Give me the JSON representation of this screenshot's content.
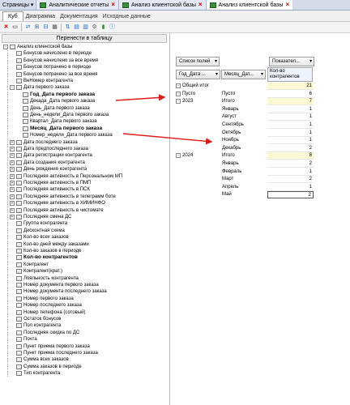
{
  "tabs": {
    "pages": "Страницы",
    "items": [
      {
        "label": "Аналитические отчеты"
      },
      {
        "label": "Анализ клиентской базы"
      },
      {
        "label": "Анализ клиентской базы"
      }
    ]
  },
  "subtabs": {
    "cube": "Куб",
    "diagram": "Диаграмма",
    "docs": "Документация",
    "source": "Исходные данные"
  },
  "left": {
    "move_button": "Перенести в таблицу",
    "tree": [
      {
        "label": "Анализ клиентской базы",
        "lvl": 0,
        "exp": "-",
        "bold": false
      },
      {
        "label": "Бонусов начислено в периоде",
        "lvl": 1,
        "exp": "",
        "bold": false
      },
      {
        "label": "Бонусов начислено за все время",
        "lvl": 1,
        "exp": "",
        "bold": false
      },
      {
        "label": "Бонусов потрачено в периоде",
        "lvl": 1,
        "exp": "",
        "bold": false
      },
      {
        "label": "Бонусов потрачено за все время",
        "lvl": 1,
        "exp": "",
        "bold": false
      },
      {
        "label": "ВнНомер контрагента",
        "lvl": 1,
        "exp": "",
        "bold": false
      },
      {
        "label": "Дата первого заказа",
        "lvl": 1,
        "exp": "-",
        "bold": false
      },
      {
        "label": "Год_Дата первого заказа",
        "lvl": 2,
        "exp": "",
        "bold": true
      },
      {
        "label": "Декада_Дата первого заказа",
        "lvl": 2,
        "exp": "",
        "bold": false
      },
      {
        "label": "День_Дата первого заказа",
        "lvl": 2,
        "exp": "",
        "bold": false
      },
      {
        "label": "День_недели_Дата первого заказа",
        "lvl": 2,
        "exp": "",
        "bold": false
      },
      {
        "label": "Квартал_Дата первого заказа",
        "lvl": 2,
        "exp": "",
        "bold": false
      },
      {
        "label": "Месяц_Дата первого заказа",
        "lvl": 2,
        "exp": "",
        "bold": true
      },
      {
        "label": "Номер_недели_Дата первого заказа",
        "lvl": 2,
        "exp": "",
        "bold": false
      },
      {
        "label": "Дата последнего заказа",
        "lvl": 1,
        "exp": "+",
        "bold": false
      },
      {
        "label": "Дата предпоследнего заказа",
        "lvl": 1,
        "exp": "+",
        "bold": false
      },
      {
        "label": "Дата регистрации контрагента",
        "lvl": 1,
        "exp": "+",
        "bold": false
      },
      {
        "label": "Дата создания контрагента",
        "lvl": 1,
        "exp": "+",
        "bold": false
      },
      {
        "label": "День рождения контрагента",
        "lvl": 1,
        "exp": "+",
        "bold": false
      },
      {
        "label": "Последняя активность в Персональном МП",
        "lvl": 1,
        "exp": "+",
        "bold": false
      },
      {
        "label": "Последняя активность в ПМП",
        "lvl": 1,
        "exp": "+",
        "bold": false
      },
      {
        "label": "Последняя активность в ПСК",
        "lvl": 1,
        "exp": "+",
        "bold": false
      },
      {
        "label": "Последняя активность в телеграмм боте",
        "lvl": 1,
        "exp": "+",
        "bold": false
      },
      {
        "label": "Последняя активность в ХИМИНФО",
        "lvl": 1,
        "exp": "+",
        "bold": false
      },
      {
        "label": "Последняя активность в чистомате",
        "lvl": 1,
        "exp": "+",
        "bold": false
      },
      {
        "label": "Последняя смена ДС",
        "lvl": 1,
        "exp": "+",
        "bold": false
      },
      {
        "label": "Группа контрагента",
        "lvl": 1,
        "exp": "",
        "bold": false
      },
      {
        "label": "Дисконтная схема",
        "lvl": 1,
        "exp": "",
        "bold": false
      },
      {
        "label": "Кол-во всех заказов",
        "lvl": 1,
        "exp": "",
        "bold": false
      },
      {
        "label": "Кол-во дней между заказами",
        "lvl": 1,
        "exp": "",
        "bold": false
      },
      {
        "label": "Кол-во заказов в периоде",
        "lvl": 1,
        "exp": "",
        "bold": false
      },
      {
        "label": "Кол-во контрагентов",
        "lvl": 1,
        "exp": "",
        "bold": true
      },
      {
        "label": "Контрагент",
        "lvl": 1,
        "exp": "",
        "bold": false
      },
      {
        "label": "Контрагент(крат.)",
        "lvl": 1,
        "exp": "",
        "bold": false
      },
      {
        "label": "Лояльность контрагента",
        "lvl": 1,
        "exp": "",
        "bold": false
      },
      {
        "label": "Номер документа первого заказа",
        "lvl": 1,
        "exp": "",
        "bold": false
      },
      {
        "label": "Номер документа последнего заказа",
        "lvl": 1,
        "exp": "",
        "bold": false
      },
      {
        "label": "Номер первого заказа",
        "lvl": 1,
        "exp": "",
        "bold": false
      },
      {
        "label": "Номер последнего заказа",
        "lvl": 1,
        "exp": "",
        "bold": false
      },
      {
        "label": "Номер телефона (сотовый)",
        "lvl": 1,
        "exp": "",
        "bold": false
      },
      {
        "label": "Остаток бонусов",
        "lvl": 1,
        "exp": "",
        "bold": false
      },
      {
        "label": "Пол контрагента",
        "lvl": 1,
        "exp": "",
        "bold": false
      },
      {
        "label": "Последняя скидка по ДС",
        "lvl": 1,
        "exp": "",
        "bold": false
      },
      {
        "label": "Почта",
        "lvl": 1,
        "exp": "",
        "bold": false
      },
      {
        "label": "Пункт приема первого заказа",
        "lvl": 1,
        "exp": "",
        "bold": false
      },
      {
        "label": "Пункт приема последнего заказа",
        "lvl": 1,
        "exp": "",
        "bold": false
      },
      {
        "label": "Сумма всех заказов",
        "lvl": 1,
        "exp": "",
        "bold": false
      },
      {
        "label": "Сумма заказов в периоде",
        "lvl": 1,
        "exp": "",
        "bold": false
      },
      {
        "label": "Тип контрагента",
        "lvl": 1,
        "exp": "",
        "bold": false
      }
    ]
  },
  "pivot": {
    "fields_list": "Список полей",
    "indicators": "Показател...",
    "row_field_1": "Год_Дата ...",
    "row_field_2": "Месяц_Дат...",
    "measure": "Кол-во контрагентов",
    "rows": [
      {
        "c1": "Общий итог",
        "c1exp": "-",
        "c2": "",
        "v": "21",
        "hl": true
      },
      {
        "c1": "Пусто",
        "c1exp": "-",
        "c2": "Пусто",
        "v": "6",
        "hl": false
      },
      {
        "c1": "2023",
        "c1exp": "-",
        "c2": "Итого",
        "v": "7",
        "hl": true
      },
      {
        "c1": "",
        "c1exp": "",
        "c2": "Январь",
        "v": "1",
        "hl": false
      },
      {
        "c1": "",
        "c1exp": "",
        "c2": "Август",
        "v": "1",
        "hl": false
      },
      {
        "c1": "",
        "c1exp": "",
        "c2": "Сентябрь",
        "v": "1",
        "hl": false
      },
      {
        "c1": "",
        "c1exp": "",
        "c2": "Октябрь",
        "v": "1",
        "hl": false
      },
      {
        "c1": "",
        "c1exp": "",
        "c2": "Ноябрь",
        "v": "1",
        "hl": false
      },
      {
        "c1": "",
        "c1exp": "",
        "c2": "Декабрь",
        "v": "2",
        "hl": false
      },
      {
        "c1": "2024",
        "c1exp": "-",
        "c2": "Итого",
        "v": "8",
        "hl": true
      },
      {
        "c1": "",
        "c1exp": "",
        "c2": "Январь",
        "v": "2",
        "hl": false
      },
      {
        "c1": "",
        "c1exp": "",
        "c2": "Февраль",
        "v": "1",
        "hl": false
      },
      {
        "c1": "",
        "c1exp": "",
        "c2": "Март",
        "v": "2",
        "hl": false
      },
      {
        "c1": "",
        "c1exp": "",
        "c2": "Апрель",
        "v": "1",
        "hl": false
      },
      {
        "c1": "",
        "c1exp": "",
        "c2": "Май",
        "v": "2",
        "hl": false
      }
    ]
  },
  "colors": {
    "accent_red": "#e11b1b",
    "header_bg": "#d6dbe9",
    "selection": "#dde9f7"
  }
}
